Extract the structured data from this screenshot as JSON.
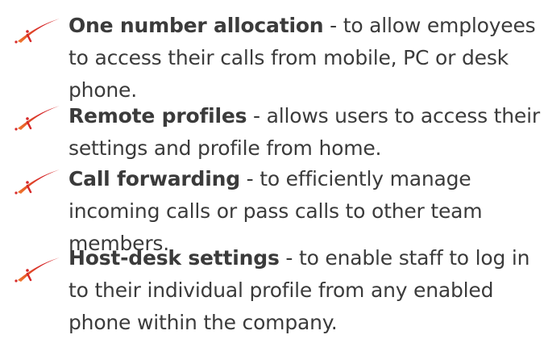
{
  "colors": {
    "text": "#3b3b3b",
    "swoosh_red": "#d62828",
    "swoosh_orange": "#f07a2a"
  },
  "bullet_icon": "red-swoosh-bullet-icon",
  "features": [
    {
      "title": "One number allocation",
      "line1": " - to allow employees",
      "line2": "to access their calls from mobile, PC or desk",
      "line3": "phone."
    },
    {
      "title": "Remote profiles",
      "line1": " - allows users to access their",
      "line2": "settings and profile from home."
    },
    {
      "title": "Call forwarding",
      "line1": " - to efficiently manage",
      "line2": "incoming calls or pass calls to other team",
      "line3": "members."
    },
    {
      "title": "Host-desk settings",
      "line1": " - to enable staff to log in",
      "line2": "to their individual profile from any enabled",
      "line3": "phone within the company."
    }
  ]
}
